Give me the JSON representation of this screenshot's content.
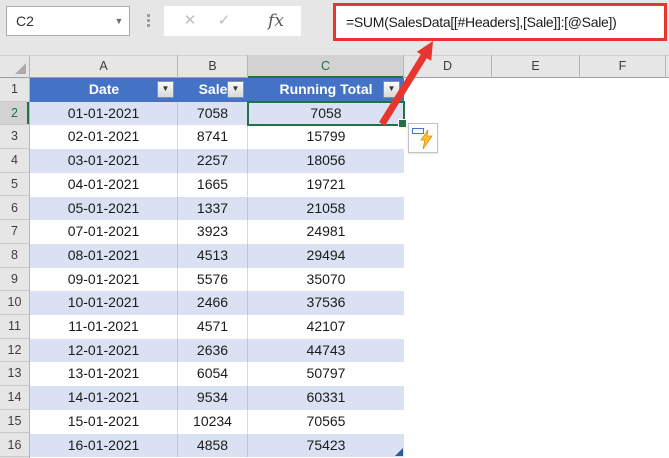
{
  "formula_bar": {
    "name_box_value": "C2",
    "formula": "=SUM(SalesData[[#Headers],[Sale]]:[@Sale])",
    "cancel_label": "✕",
    "enter_label": "✓",
    "insert_function_label": "fx",
    "name_box_dropdown_glyph": "▼"
  },
  "grid": {
    "columns": [
      "A",
      "B",
      "C",
      "D",
      "E",
      "F"
    ],
    "selected_column": "C",
    "selected_row": "2",
    "selected_cell": "C2"
  },
  "table": {
    "name": "SalesData",
    "header_row_number": "1",
    "headers": [
      "Date",
      "Sale",
      "Running Total"
    ],
    "rows": [
      {
        "n": "2",
        "date": "01-01-2021",
        "sale": "7058",
        "total": "7058"
      },
      {
        "n": "3",
        "date": "02-01-2021",
        "sale": "8741",
        "total": "15799"
      },
      {
        "n": "4",
        "date": "03-01-2021",
        "sale": "2257",
        "total": "18056"
      },
      {
        "n": "5",
        "date": "04-01-2021",
        "sale": "1665",
        "total": "19721"
      },
      {
        "n": "6",
        "date": "05-01-2021",
        "sale": "1337",
        "total": "21058"
      },
      {
        "n": "7",
        "date": "07-01-2021",
        "sale": "3923",
        "total": "24981"
      },
      {
        "n": "8",
        "date": "08-01-2021",
        "sale": "4513",
        "total": "29494"
      },
      {
        "n": "9",
        "date": "09-01-2021",
        "sale": "5576",
        "total": "35070"
      },
      {
        "n": "10",
        "date": "10-01-2021",
        "sale": "2466",
        "total": "37536"
      },
      {
        "n": "11",
        "date": "11-01-2021",
        "sale": "4571",
        "total": "42107"
      },
      {
        "n": "12",
        "date": "12-01-2021",
        "sale": "2636",
        "total": "44743"
      },
      {
        "n": "13",
        "date": "13-01-2021",
        "sale": "6054",
        "total": "50797"
      },
      {
        "n": "14",
        "date": "14-01-2021",
        "sale": "9534",
        "total": "60331"
      },
      {
        "n": "15",
        "date": "15-01-2021",
        "sale": "10234",
        "total": "70565"
      },
      {
        "n": "16",
        "date": "16-01-2021",
        "sale": "4858",
        "total": "75423"
      }
    ]
  },
  "icons": {
    "filter_dropdown": "▼",
    "flash_fill_bolt": "lightning-bolt",
    "select_all_corner": "triangle"
  },
  "colors": {
    "header_blue": "#4472C4",
    "band_blue": "#D9E1F2",
    "selection_green": "#217346",
    "annotation_red": "#E8352D"
  }
}
